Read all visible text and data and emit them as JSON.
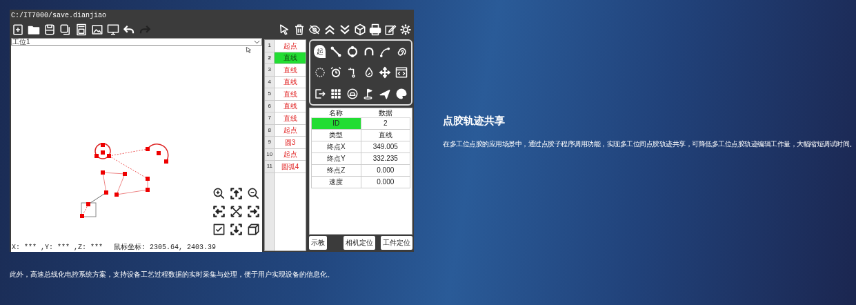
{
  "window": {
    "title": "C:/IT7000/save.dianjiao"
  },
  "station_select": {
    "value": "工位1"
  },
  "status_bar": {
    "axes": "X: *** ,Y: *** ,Z: ***",
    "mouse": "鼠标坐标: 2305.64, 2403.39"
  },
  "program_list": [
    {
      "number": "1",
      "label": "起点",
      "selected": false
    },
    {
      "number": "2",
      "label": "直线",
      "selected": true
    },
    {
      "number": "3",
      "label": "直线",
      "selected": false
    },
    {
      "number": "4",
      "label": "直线",
      "selected": false
    },
    {
      "number": "5",
      "label": "直线",
      "selected": false
    },
    {
      "number": "6",
      "label": "直线",
      "selected": false
    },
    {
      "number": "7",
      "label": "直线",
      "selected": false
    },
    {
      "number": "8",
      "label": "起点",
      "selected": false
    },
    {
      "number": "9",
      "label": "圆3",
      "selected": false
    },
    {
      "number": "10",
      "label": "起点",
      "selected": false
    },
    {
      "number": "11",
      "label": "圆弧4",
      "selected": false
    }
  ],
  "palette": {
    "pin_label": "起"
  },
  "properties": {
    "columns": [
      "名称",
      "数据"
    ],
    "rows": [
      {
        "name": "ID",
        "value": "2",
        "selected": true
      },
      {
        "name": "类型",
        "value": "直线",
        "selected": false
      },
      {
        "name": "终点X",
        "value": "349.005",
        "selected": false
      },
      {
        "name": "终点Y",
        "value": "332.235",
        "selected": false
      },
      {
        "name": "终点Z",
        "value": "0.000",
        "selected": false
      },
      {
        "name": "速度",
        "value": "0.000",
        "selected": false
      }
    ]
  },
  "buttons": [
    "示教",
    "相机定位",
    "工件定位"
  ],
  "caption": "此外，高速总线化电控系统方案，支持设备工艺过程数据的实时采集与处理，便于用户实现设备的信息化。",
  "feature": {
    "title": "点胶轨迹共享",
    "description": "在多工位点胶的应用场景中，通过点胶子程序调用功能，实现多工位间点胶轨迹共享，可降低多工位点胶轨迹编辑工作量，大幅缩短调试时间。"
  }
}
